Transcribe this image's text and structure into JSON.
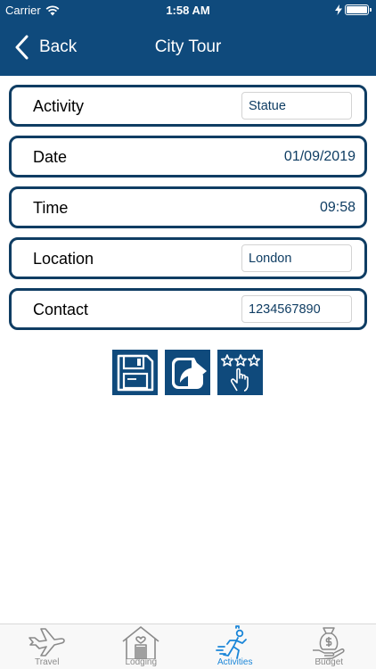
{
  "status_bar": {
    "carrier": "Carrier",
    "time": "1:58 AM"
  },
  "nav": {
    "back_label": "Back",
    "title": "City Tour"
  },
  "form": {
    "activity": {
      "label": "Activity",
      "value": "Statue"
    },
    "date": {
      "label": "Date",
      "value": "01/09/2019"
    },
    "time": {
      "label": "Time",
      "value": "09:58"
    },
    "location": {
      "label": "Location",
      "value": "London"
    },
    "contact": {
      "label": "Contact",
      "value": "1234567890"
    }
  },
  "actions": {
    "icons": [
      "floppy-disk-icon",
      "share-arrow-icon",
      "rate-stars-icon"
    ]
  },
  "tabs": [
    {
      "label": "Travel",
      "icon": "airplane-icon",
      "active": false
    },
    {
      "label": "Lodging",
      "icon": "house-icon",
      "active": false
    },
    {
      "label": "Activities",
      "icon": "running-person-icon",
      "active": true
    },
    {
      "label": "Budget",
      "icon": "money-bag-hand-icon",
      "active": false
    }
  ],
  "colors": {
    "nav_bg": "#0f4a7c",
    "border": "#0f3d63",
    "tab_active": "#1b86d8",
    "tab_inactive": "#8a8a8a"
  }
}
